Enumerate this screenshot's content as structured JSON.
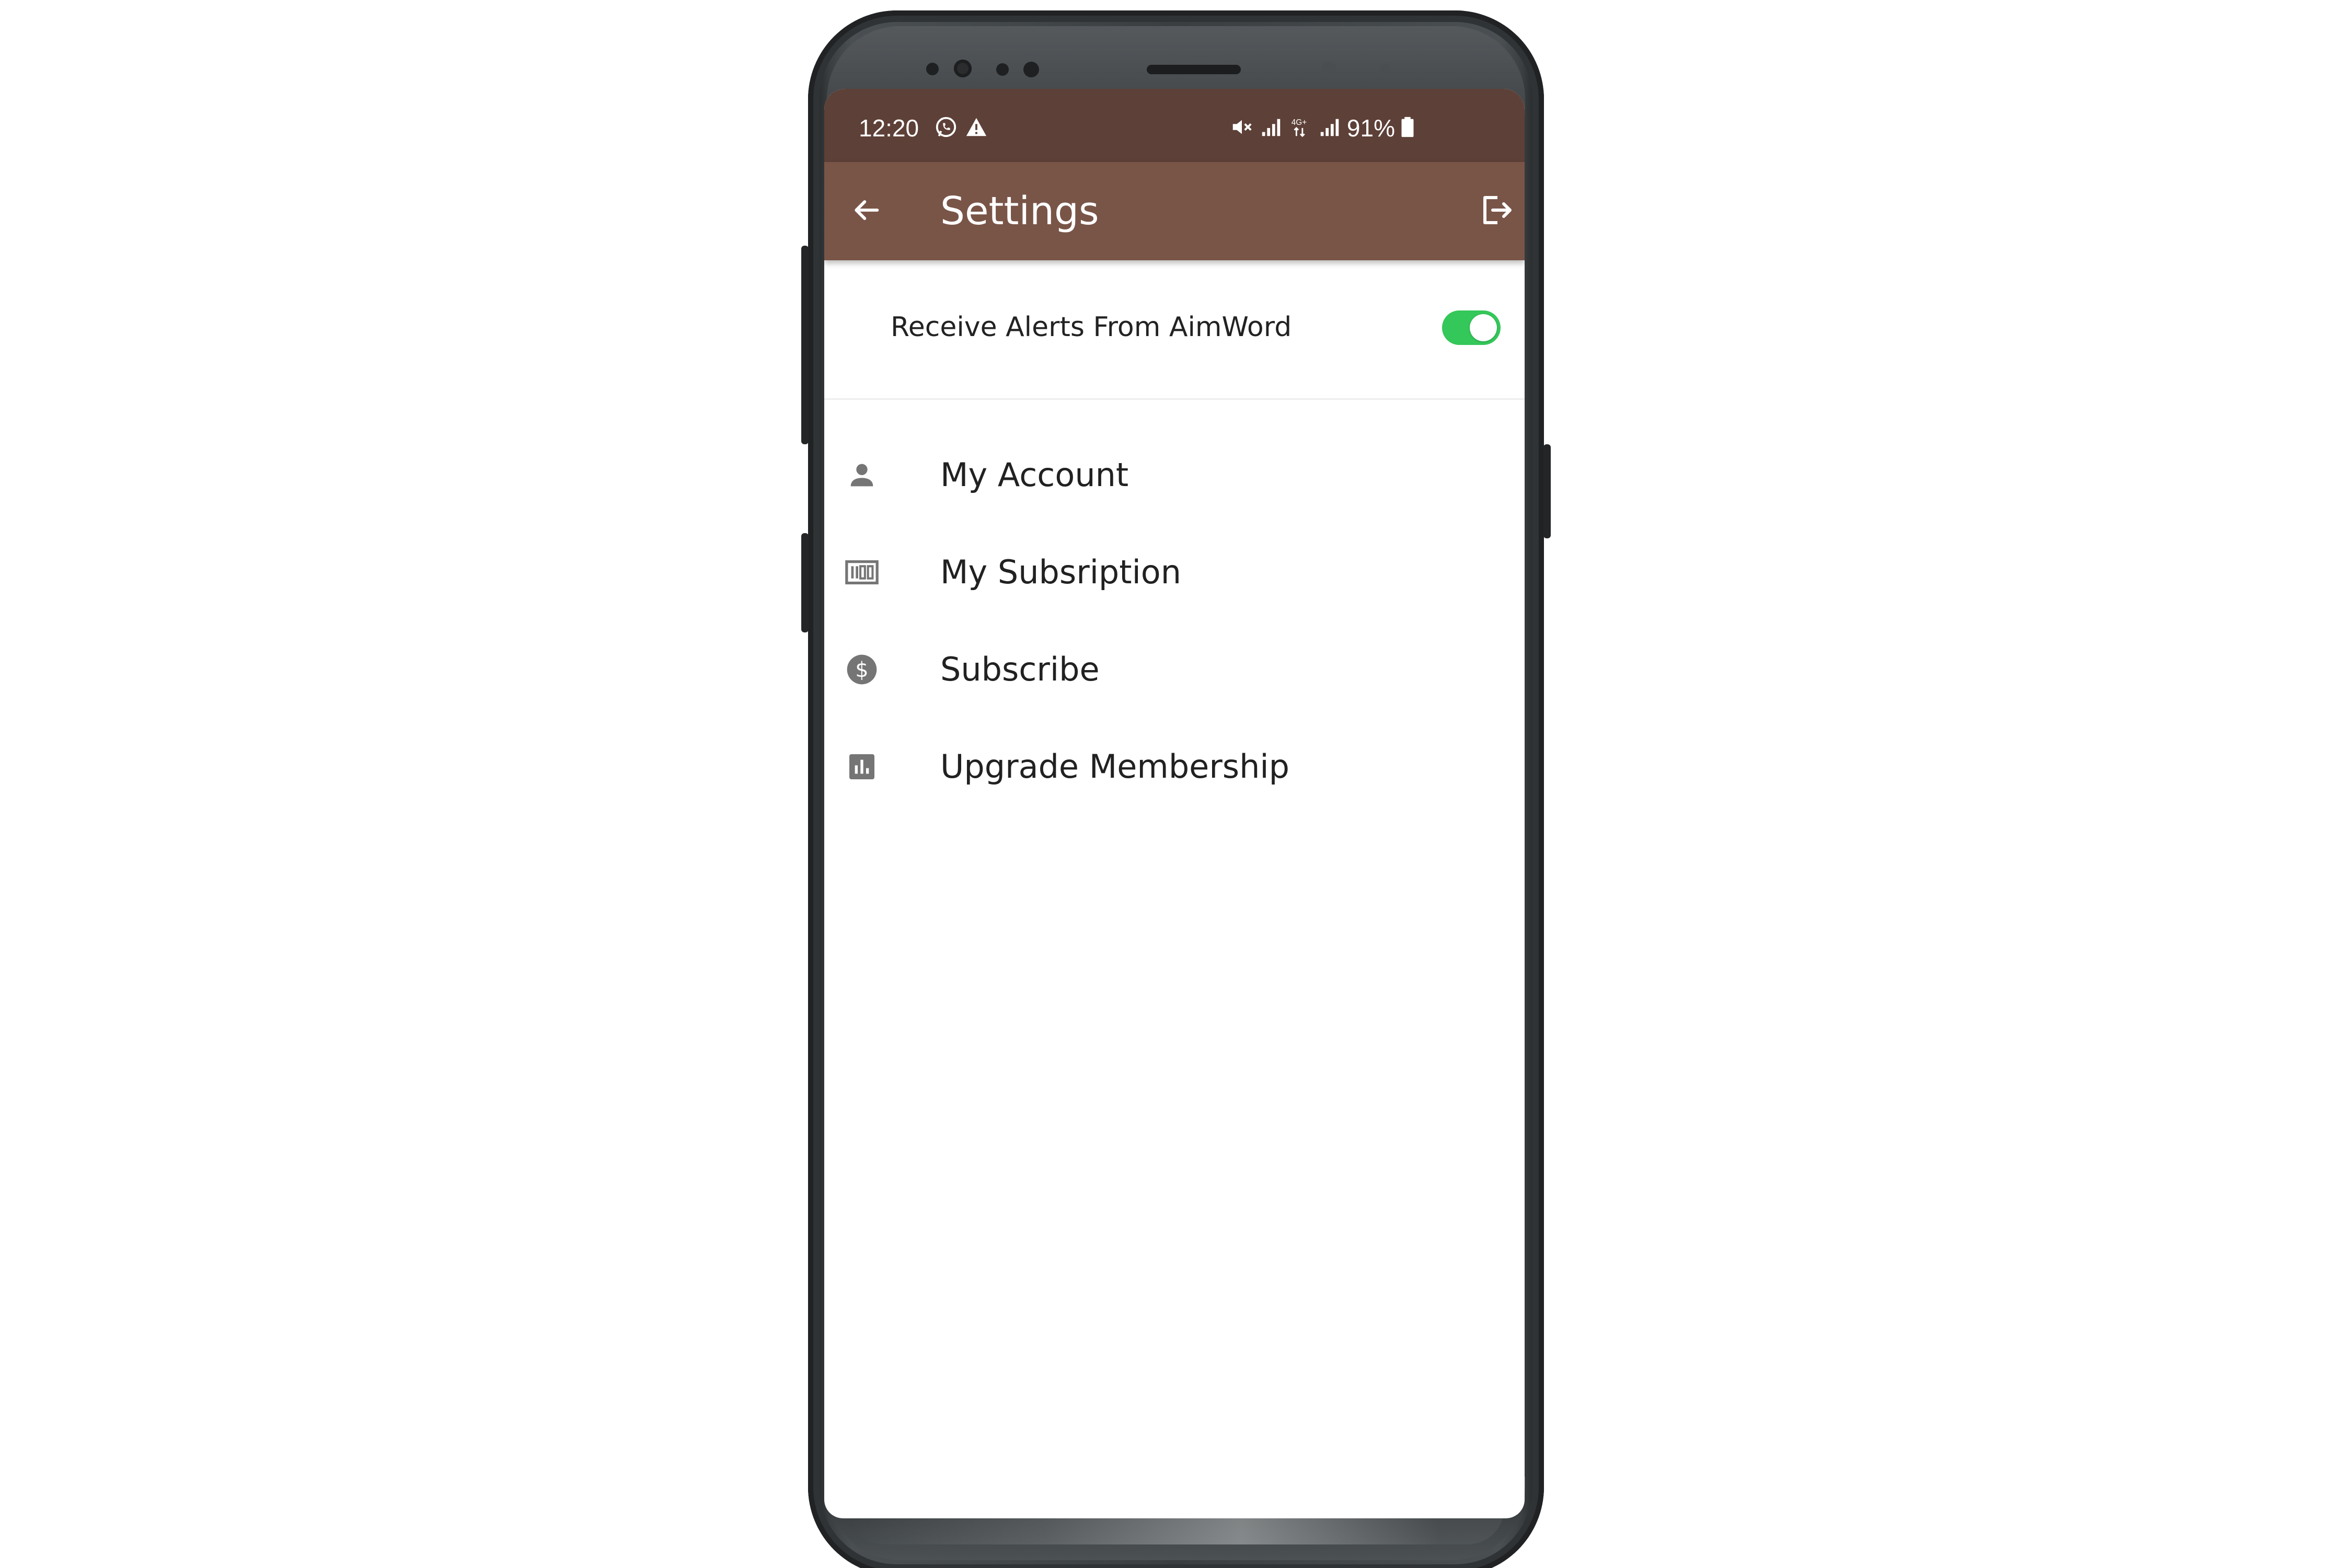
{
  "status_bar": {
    "time": "12:20",
    "battery": "91%",
    "icons": [
      "whatsapp-icon",
      "warning-icon",
      "mute-icon",
      "signal-icon",
      "4g-icon",
      "signal-icon",
      "battery-icon"
    ]
  },
  "app_bar": {
    "title": "Settings",
    "back_icon": "arrow-left-icon",
    "logout_icon": "logout-icon"
  },
  "alerts": {
    "label": "Receive Alerts From AimWord",
    "enabled": true
  },
  "menu": {
    "items": [
      {
        "label": "My Account",
        "icon": "person-icon"
      },
      {
        "label": "My Subsription",
        "icon": "barcode-icon"
      },
      {
        "label": "Subscribe",
        "icon": "dollar-icon"
      },
      {
        "label": "Upgrade Membership",
        "icon": "bar-chart-icon"
      }
    ]
  },
  "colors": {
    "status_bar": "#5d4037",
    "app_bar": "#795548",
    "toggle_on": "#34c759",
    "icon": "#757575",
    "text": "#212121"
  }
}
